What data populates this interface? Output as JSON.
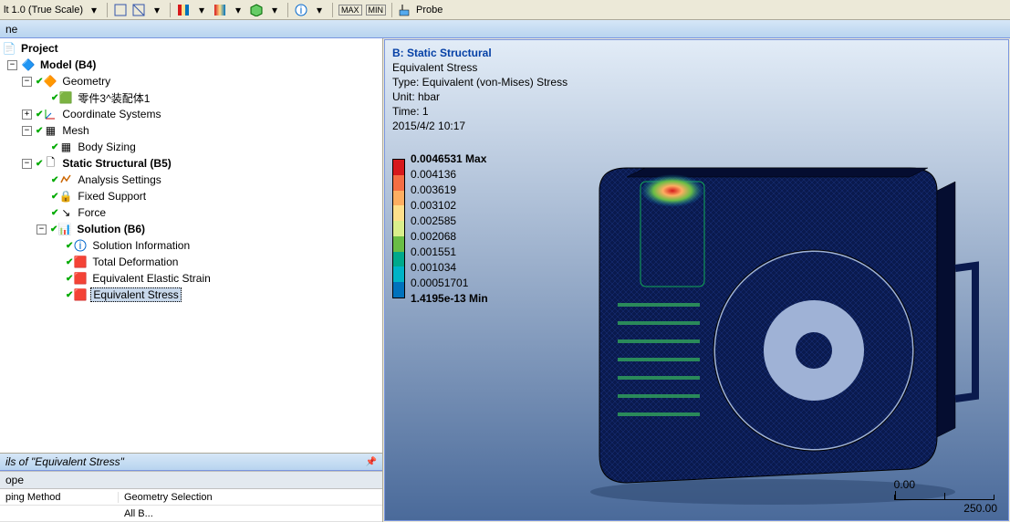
{
  "toolbar": {
    "scale_text": "lt  1.0 (True Scale)",
    "probe": "Probe",
    "max": "MAX",
    "min": "MIN"
  },
  "outline_header": "ne",
  "tree": {
    "project": "Project",
    "model": "Model (B4)",
    "geometry": "Geometry",
    "part": "零件3^装配体1",
    "coord": "Coordinate Systems",
    "mesh": "Mesh",
    "body_sizing": "Body Sizing",
    "static": "Static Structural (B5)",
    "analysis": "Analysis Settings",
    "fixed": "Fixed Support",
    "force": "Force",
    "solution": "Solution (B6)",
    "sol_info": "Solution Information",
    "total_def": "Total Deformation",
    "eq_strain": "Equivalent Elastic Strain",
    "eq_stress": "Equivalent Stress"
  },
  "details": {
    "header": "ils of \"Equivalent Stress\"",
    "group_scope": "ope",
    "scoping_method_key": "ping Method",
    "scoping_method_val": "Geometry Selection",
    "geometry_key": "",
    "geometry_val": "All B..."
  },
  "annotation": {
    "title": "B: Static Structural",
    "line1": "Equivalent Stress",
    "line2": "Type: Equivalent (von-Mises) Stress",
    "line3": "Unit: hbar",
    "line4": "Time: 1",
    "line5": "2015/4/2 10:17"
  },
  "legend": {
    "colors": [
      "#d7191c",
      "#f46d43",
      "#fdae61",
      "#fee08b",
      "#d9ef8b",
      "#69bd45",
      "#00a98b",
      "#00b3c6",
      "#0072bc"
    ],
    "labels": [
      {
        "text": "0.0046531 Max",
        "bold": true
      },
      {
        "text": "0.004136",
        "bold": false
      },
      {
        "text": "0.003619",
        "bold": false
      },
      {
        "text": "0.003102",
        "bold": false
      },
      {
        "text": "0.002585",
        "bold": false
      },
      {
        "text": "0.002068",
        "bold": false
      },
      {
        "text": "0.001551",
        "bold": false
      },
      {
        "text": "0.001034",
        "bold": false
      },
      {
        "text": "0.00051701",
        "bold": false
      },
      {
        "text": "1.4195e-13 Min",
        "bold": true
      }
    ]
  },
  "scale": {
    "zero": "0.00",
    "val": "250.00"
  },
  "chart_data": {
    "type": "table",
    "title": "Equivalent (von-Mises) Stress contour legend",
    "unit": "hbar",
    "values": [
      0.0046531,
      0.004136,
      0.003619,
      0.003102,
      0.002585,
      0.002068,
      0.001551,
      0.001034,
      0.00051701,
      1.4195e-13
    ],
    "max": 0.0046531,
    "min": 1.4195e-13
  }
}
